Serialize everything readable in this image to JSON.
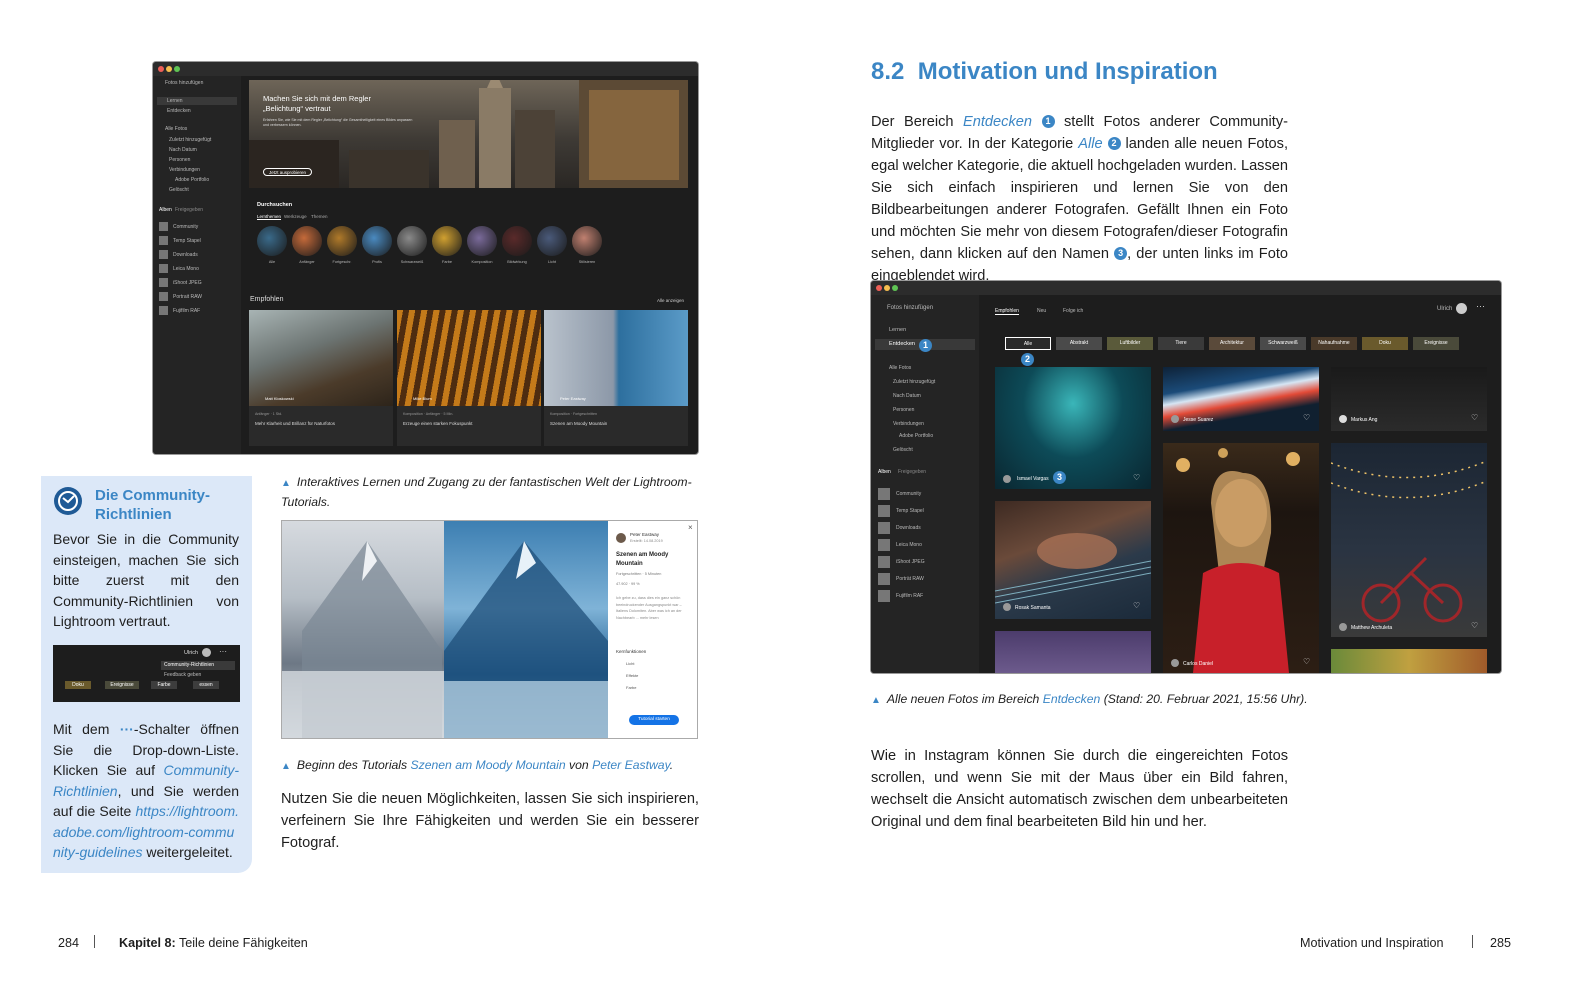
{
  "left_screenshot": {
    "sidebar": {
      "add_photos": "Fotos hinzufügen",
      "learn": "Lernen",
      "discover": "Entdecken",
      "all_photos": "Alle Fotos",
      "items": [
        "Zuletzt hinzugefügt",
        "Nach Datum",
        "Personen",
        "Verbindungen",
        "Adobe Portfolio",
        "Gelöscht"
      ],
      "tabs": [
        "Alben",
        "Freigegeben"
      ],
      "albums": [
        "Community",
        "Temp Stapel",
        "Downloads",
        "Leica Mono",
        "iShoot JPEG",
        "Portrait RAW",
        "Fujifilm RAF"
      ]
    },
    "hero": {
      "title": "Machen Sie sich mit dem Regler „Belichtung“ vertraut",
      "subtitle": "Erfahren Sie, wie Sie mit dem Regler „Belichtung“ die Gesamthelligkeit eines Bildes anpassen und verbessern können.",
      "button": "Jetzt ausprobieren"
    },
    "browse": {
      "heading": "Durchsuchen",
      "tabs": [
        "Lernthemen",
        "Werkzeuge",
        "Themen"
      ],
      "circles": [
        "Alle",
        "Anfänger",
        "Fortgeschr.",
        "Profis",
        "Schwarzweiß",
        "Farbe",
        "Komposition",
        "Bildwirkung",
        "Licht",
        "Stilisieren"
      ]
    },
    "recommended": {
      "heading": "Empfohlen",
      "see_all": "Alle anzeigen",
      "cards": [
        {
          "author": "Matt Kloskowski",
          "tag": "Anfänger · 1 Std.",
          "title": "Mehr Klarheit und Brillanz für Naturfotos"
        },
        {
          "author": "Mike Blum",
          "tag": "Komposition · Anfänger · 5 Min.",
          "title": "Erzeuge einen starken Fokuspunkt"
        },
        {
          "author": "Peter Eastway",
          "tag": "Komposition · Fortgeschritten",
          "title": "Szenen am Moody Mountain"
        }
      ]
    }
  },
  "left_caption": "Interaktives Lernen und Zugang zu der fantastischen Welt der Lightroom-Tutorials.",
  "infobox": {
    "title": "Die Community-Richtlinien",
    "intro": "Bevor Sie in die Community einsteigen, machen Sie sich bitte zuerst mit den Community-Richtlinien von Lightroom vertraut.",
    "mini_user": "Ulrich",
    "mini_menu": [
      "Community-Richtlinien",
      "Feedback geben"
    ],
    "mini_chips": [
      "Doku",
      "Ereignisse",
      "Farbe",
      "essen"
    ],
    "text_1": "Mit dem ",
    "text_switch": "···",
    "text_2": "-Schalter öffnen Sie die Drop-down-Liste. Klicken Sie auf ",
    "text_link": "Community-Richtlinien",
    "text_3": ", und Sie werden auf die Seite ",
    "url": "https://lightroom.adobe.com/lightroom-community-guidelines",
    "text_4": " weitergeleitet."
  },
  "tutorial_panel": {
    "author": "Peter Eastway",
    "date": "Erstellt: 14.08.2019",
    "title": "Szenen am Moody Mountain",
    "meta": "Fortgeschritten · 5 Minuten",
    "stats": "47.902 · 99 %",
    "desc": "Ich gebe zu, dass dies ein ganz schön beeindruckender Ausgangspunkt war – Italiens Dolomiten. Aber was ich an der Nachbearb ... mehr lesen",
    "section": "Kernfunktionen",
    "features": [
      "Licht",
      "Effekte",
      "Farbe"
    ],
    "button": "Tutorial starten"
  },
  "tutorial_caption": {
    "pre": "Beginn des Tutorials ",
    "link1": "Szenen am Moody Mountain",
    "mid": " von ",
    "link2": "Peter Eastway",
    "end": "."
  },
  "left_paragraph": "Nutzen Sie die neuen Möglichkeiten, lassen Sie sich inspirieren, verfeinern Sie Ihre Fähigkeiten und werden Sie ein besserer Fotograf.",
  "section": {
    "number": "8.2",
    "title": "Motivation und Inspiration"
  },
  "intro": {
    "p1": "Der Bereich ",
    "link1": "Entdecken",
    "n1": "1",
    "p2": " stellt Fotos anderer Community-Mitglieder vor. In der Kategorie ",
    "link2": "Alle",
    "n2": "2",
    "p3": " landen alle neuen Fotos, egal welcher Kategorie, die aktuell hochgeladen wurden. Lassen Sie sich einfach inspirieren und lernen Sie von den Bildbearbeitungen anderer Fotografen. Gefällt Ihnen ein Foto und möchten Sie mehr von diesem Fotografen/dieser Fotografin sehen, dann klicken auf den Namen ",
    "n3": "3",
    "p4": ", der unten links im Foto eingeblendet wird."
  },
  "right_screenshot": {
    "sidebar": {
      "add_photos": "Fotos hinzufügen",
      "learn": "Lernen",
      "discover": "Entdecken",
      "all_photos": "Alle Fotos",
      "items": [
        "Zuletzt hinzugefügt",
        "Nach Datum",
        "Personen",
        "Verbindungen",
        "Adobe Portfolio",
        "Gelöscht"
      ],
      "tabs": [
        "Alben",
        "Freigegeben"
      ],
      "albums": [
        "Community",
        "Temp Stapel",
        "Downloads",
        "Leica Mono",
        "iShoot JPEG",
        "Porträt RAW",
        "Fujifilm RAF"
      ]
    },
    "top_tabs": [
      "Empfohlen",
      "Neu",
      "Folge ich"
    ],
    "user": "Ulrich",
    "categories": [
      "Alle",
      "Abstrakt",
      "Luftbilder",
      "Tiere",
      "Architektur",
      "Schwarzweiß",
      "Nahaufnahme",
      "Doku",
      "Ereignisse"
    ],
    "markers": {
      "discover": "1",
      "all": "2",
      "name": "3"
    },
    "authors": [
      "Ismael Vargas",
      "Jesse Suarez",
      "Markus Ang",
      "Rosak Samanta",
      "Carlos Daniel",
      "Matthew Archuleta"
    ]
  },
  "right_caption": {
    "pre": "Alle neuen Fotos im Bereich ",
    "link": "Entdecken",
    "end": " (Stand: 20. Februar 2021, 15:56 Uhr)."
  },
  "right_paragraph": "Wie in Instagram können Sie durch die eingereichten Fotos scrollen, und wenn Sie mit der Maus über ein Bild fahren, wechselt die Ansicht automatisch zwischen dem unbearbeiteten Original und dem final bearbeiteten Bild hin und her.",
  "footer": {
    "left_page": "284",
    "left_chapter_bold": "Kapitel 8:",
    "left_chapter": " Teile deine Fähigkeiten",
    "right_title": "Motivation und Inspiration",
    "right_page": "285"
  },
  "colors": {
    "accent": "#3b86c5",
    "infobox_bg": "#dce8f8",
    "app_dark": "#1d1d1d"
  }
}
